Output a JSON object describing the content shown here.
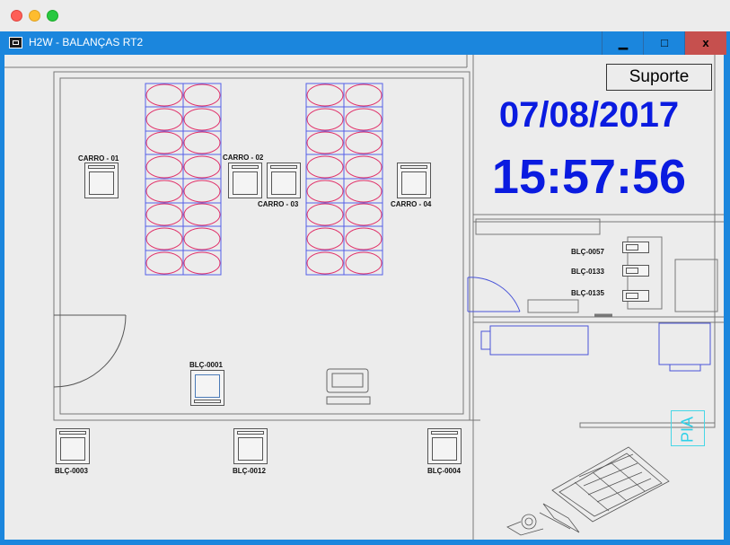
{
  "window": {
    "title": "H2W - BALANÇAS RT2",
    "minimize_label": "▁",
    "maximize_label": "□",
    "close_label": "x"
  },
  "header": {
    "support_label": "Suporte",
    "date": "07/08/2017",
    "time": "15:57:56"
  },
  "carts": [
    {
      "label": "CARRO - 01"
    },
    {
      "label": "CARRO - 02"
    },
    {
      "label": "CARRO - 03"
    },
    {
      "label": "CARRO - 04"
    }
  ],
  "scales": [
    {
      "label": "BLÇ-0001"
    },
    {
      "label": "BLÇ-0003"
    },
    {
      "label": "BLÇ-0012"
    },
    {
      "label": "BLÇ-0004"
    },
    {
      "label": "BLÇ-0057"
    },
    {
      "label": "BLÇ-0133"
    },
    {
      "label": "BLÇ-0135"
    }
  ],
  "room": {
    "sink_label": "PIA"
  },
  "colors": {
    "accent_blue": "#0a1be0",
    "titlebar": "#1b86dd",
    "close_red": "#c6504e",
    "rack_line": "#5560e8",
    "rack_oval": "#e0306a",
    "pia": "#2ed0e8"
  }
}
